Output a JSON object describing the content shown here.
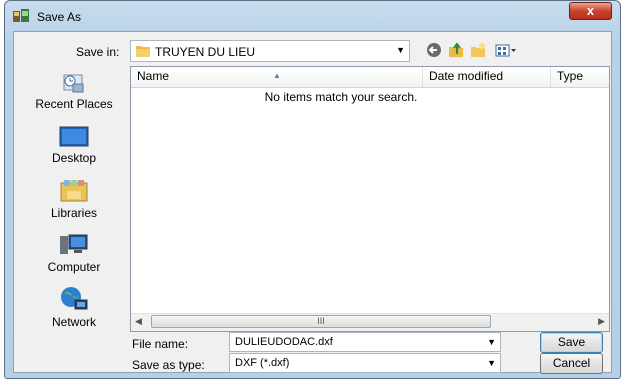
{
  "window": {
    "title": "Save As",
    "close_symbol": "x"
  },
  "toolbar": {
    "save_in_label": "Save in:",
    "current_folder": "TRUYEN DU LIEU",
    "icons": [
      "back-icon",
      "up-folder-icon",
      "new-folder-icon",
      "view-menu-icon"
    ]
  },
  "places": [
    {
      "label": "Recent Places",
      "icon": "recent-places-icon"
    },
    {
      "label": "Desktop",
      "icon": "desktop-icon"
    },
    {
      "label": "Libraries",
      "icon": "libraries-icon"
    },
    {
      "label": "Computer",
      "icon": "computer-icon"
    },
    {
      "label": "Network",
      "icon": "network-icon"
    }
  ],
  "file_list": {
    "columns": [
      "Name",
      "Date modified",
      "Type"
    ],
    "empty_message": "No items match your search.",
    "scroll_grip": "III"
  },
  "form": {
    "file_name_label": "File name:",
    "file_name_value": "DULIEUDODAC.dxf",
    "save_type_label": "Save as type:",
    "save_type_value": "DXF (*.dxf)"
  },
  "buttons": {
    "save": "Save",
    "cancel": "Cancel"
  },
  "colors": {
    "title_bar": "#b9d1e8",
    "close_button": "#c7432b",
    "client_bg": "#f0f0f0"
  }
}
